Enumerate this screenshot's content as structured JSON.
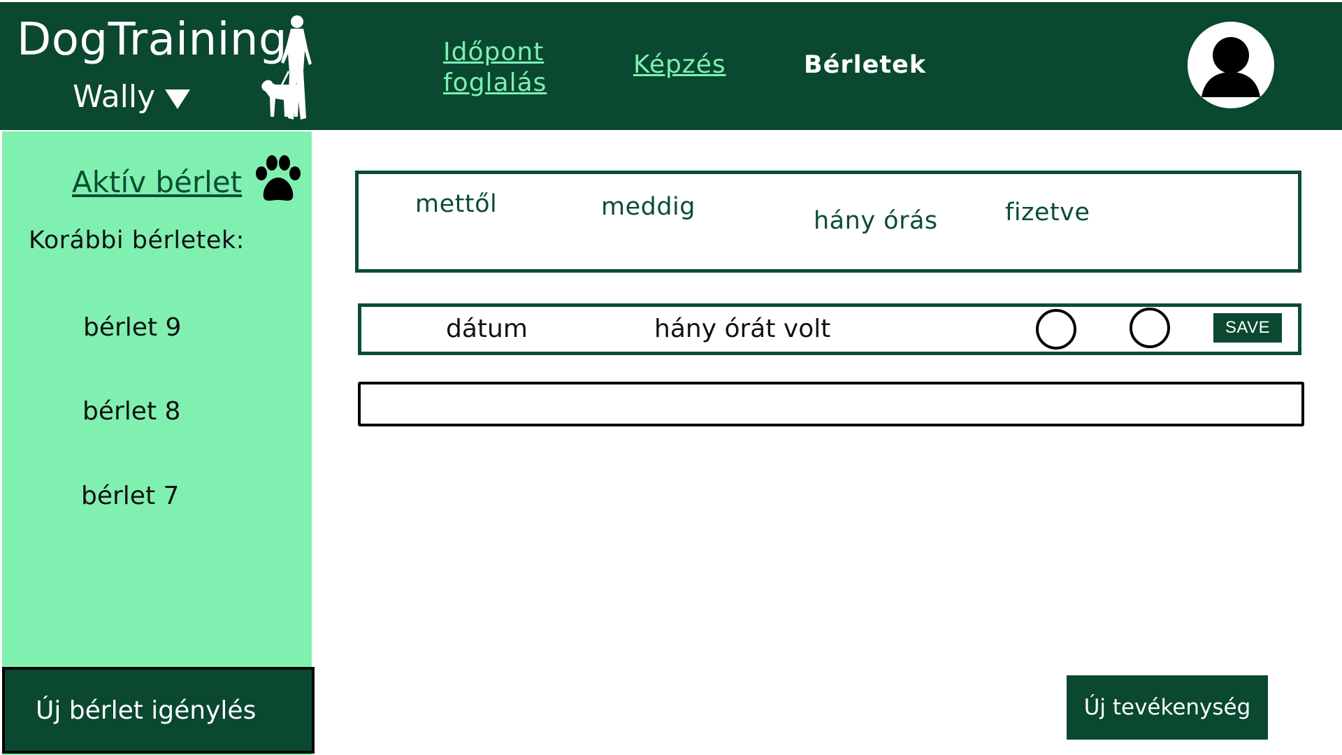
{
  "header": {
    "brand": "DogTraining",
    "dog_name": "Wally",
    "nav": {
      "idopont": "Időpont foglalás",
      "kepzes": "Képzés",
      "berletek": "Bérletek"
    }
  },
  "sidebar": {
    "active_label": "Aktív bérlet",
    "previous_label": "Korábbi bérletek:",
    "items": [
      {
        "label": "bérlet 9"
      },
      {
        "label": "bérlet 8"
      },
      {
        "label": "bérlet 7"
      }
    ],
    "new_pass_button": "Új bérlet igénylés"
  },
  "main": {
    "pass_columns": {
      "from": "mettől",
      "to": "meddig",
      "hours": "hány órás",
      "paid": "fizetve"
    },
    "entry_row": {
      "date": "dátum",
      "hours": "hány órát volt",
      "save": "SAVE"
    },
    "new_activity_button": "Új tevékenység"
  },
  "colors": {
    "primary_dark": "#0a4830",
    "sidebar_green": "#80f0b0",
    "link_green": "#7ef0b0"
  }
}
